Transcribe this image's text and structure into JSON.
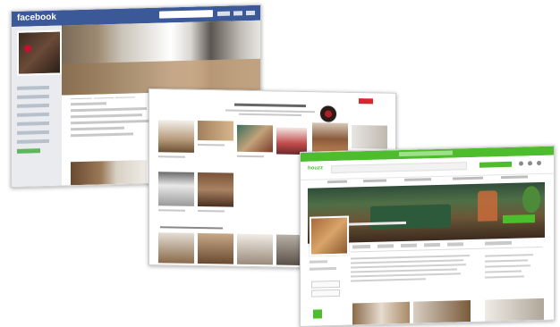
{
  "facebook": {
    "brand": "facebook",
    "colors": {
      "bar": "#3b5998",
      "sidebar": "#e9ebee",
      "accent": "#5cb85c"
    }
  },
  "pinterest": {
    "colors": {
      "accent": "#d9252c"
    }
  },
  "houzz": {
    "brand": "houzz",
    "colors": {
      "accent": "#4dbd2e"
    }
  }
}
